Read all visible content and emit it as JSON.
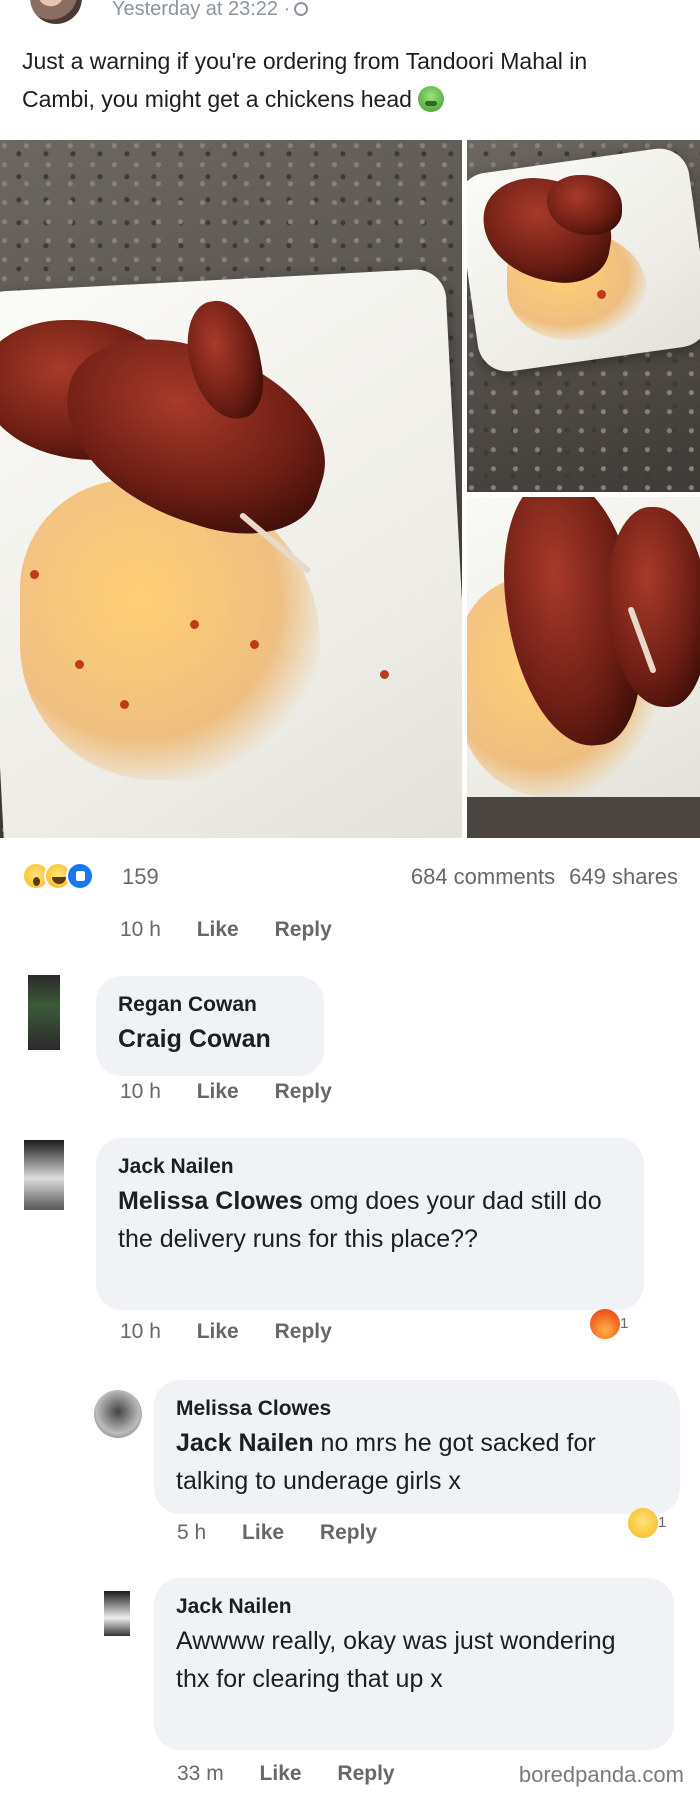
{
  "post": {
    "timestamp": "Yesterday at 23:22 ·",
    "text": "Just a warning if you're ordering from Tandoori Mahal in Cambi, you might get a chickens head",
    "reaction_count": "159",
    "comments_count": "684 comments",
    "shares_count": "649 shares",
    "reaction_icons": [
      "wow-icon",
      "haha-icon",
      "like-icon"
    ]
  },
  "first_meta": {
    "time": "10 h",
    "like": "Like",
    "reply": "Reply"
  },
  "comments": [
    {
      "author": "Regan Cowan",
      "mention": "Craig Cowan",
      "body": "",
      "time": "10 h",
      "like": "Like",
      "reply": "Reply"
    },
    {
      "author": "Jack Nailen",
      "mention": "Melissa Clowes",
      "body": " omg does your dad still do the delivery runs for this place??",
      "time": "10 h",
      "like": "Like",
      "reply": "Reply",
      "reaction_count": "1"
    },
    {
      "author": "Melissa Clowes",
      "mention": "Jack Nailen",
      "body": " no mrs he got sacked for talking to underage girls x",
      "time": "5 h",
      "like": "Like",
      "reply": "Reply",
      "reaction_count": "1"
    },
    {
      "author": "Jack Nailen",
      "mention": "",
      "body": "Awwww really, okay was just wondering thx for clearing that up x",
      "time": "33 m",
      "like": "Like",
      "reply": "Reply"
    }
  ],
  "watermark": "boredpanda.com",
  "colors": {
    "bubble": "#f0f2f5",
    "like_blue": "#1877f2",
    "meta_gray": "#65676b"
  }
}
